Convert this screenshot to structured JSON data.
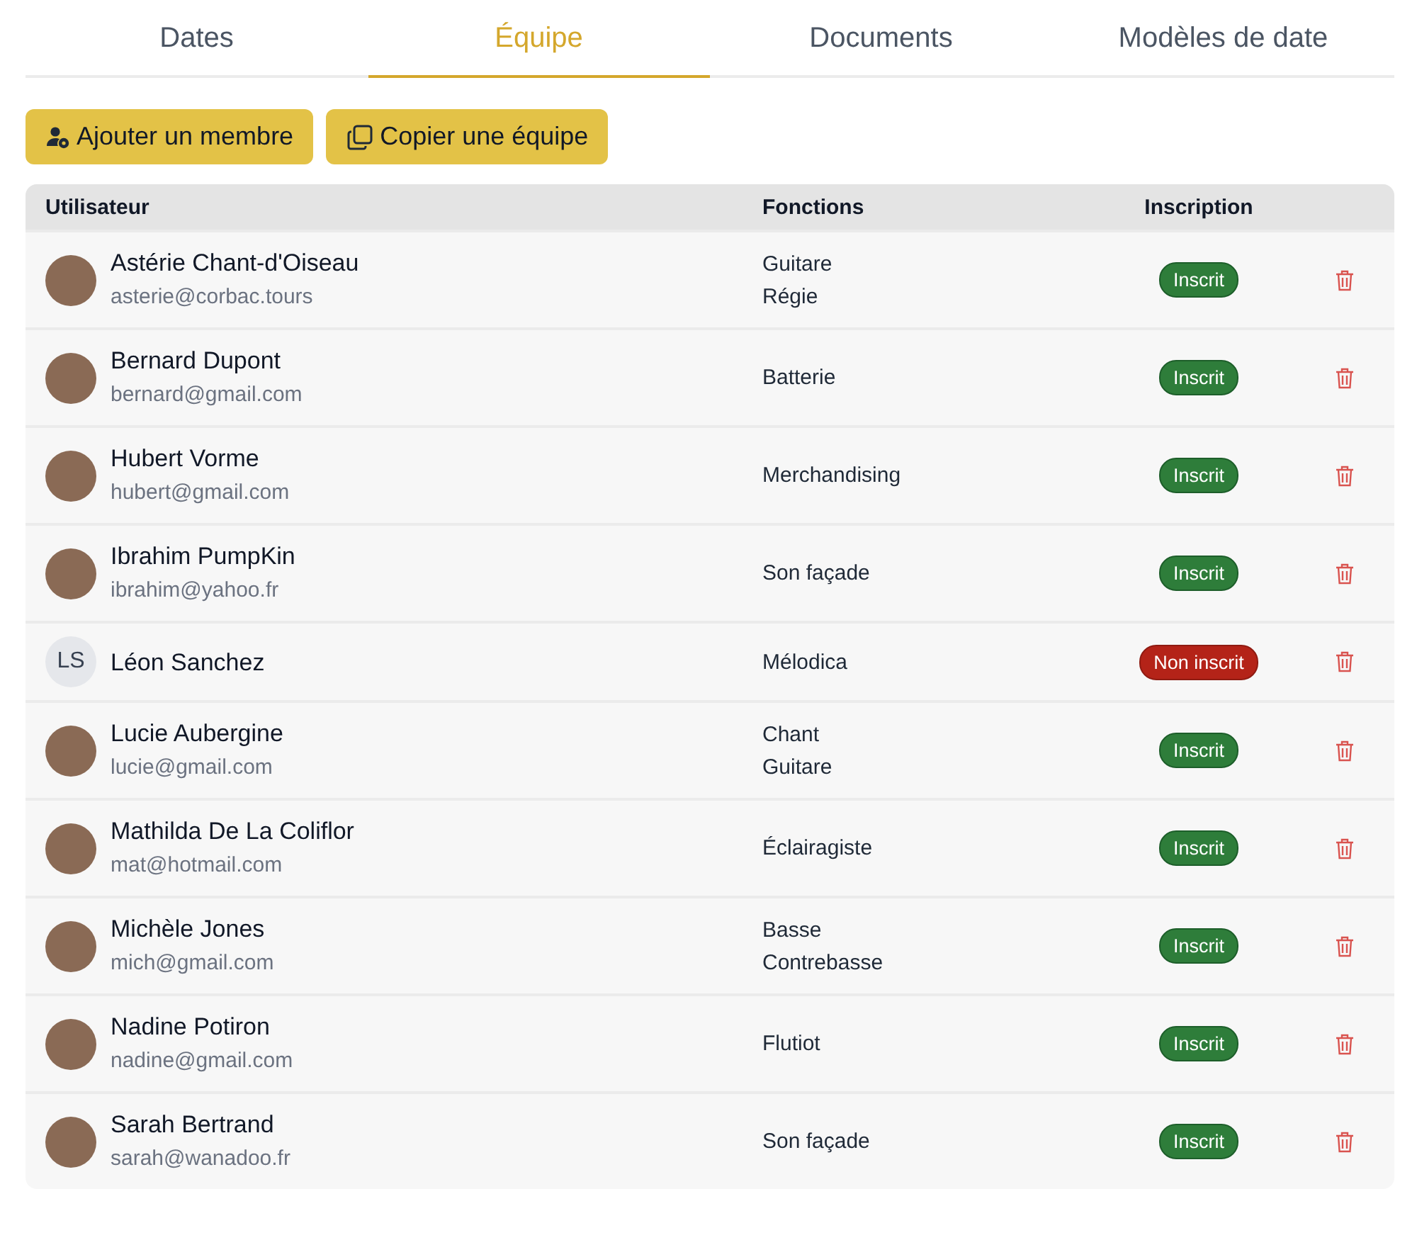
{
  "tabs": [
    {
      "label": "Dates",
      "selected": false
    },
    {
      "label": "Équipe",
      "selected": true
    },
    {
      "label": "Documents",
      "selected": false
    },
    {
      "label": "Modèles de date",
      "selected": false
    }
  ],
  "actions": [
    {
      "kind": "add-member",
      "label": "Ajouter un membre"
    },
    {
      "kind": "copy",
      "label": "Copier une équipe"
    }
  ],
  "table": {
    "columns": [
      "Utilisateur",
      "Fonctions",
      "Inscription"
    ],
    "rows": [
      {
        "name": "Astérie Chant-d'Oiseau",
        "email": "asterie@corbac.tours",
        "avatar": {
          "kind": "photo"
        },
        "functions": [
          "Guitare",
          "Régie"
        ],
        "status": "Inscrit",
        "registered": true
      },
      {
        "name": "Bernard Dupont",
        "email": "bernard@gmail.com",
        "avatar": {
          "kind": "photo"
        },
        "functions": [
          "Batterie"
        ],
        "status": "Inscrit",
        "registered": true
      },
      {
        "name": "Hubert Vorme",
        "email": "hubert@gmail.com",
        "avatar": {
          "kind": "photo"
        },
        "functions": [
          "Merchandising"
        ],
        "status": "Inscrit",
        "registered": true
      },
      {
        "name": "Ibrahim PumpKin",
        "email": "ibrahim@yahoo.fr",
        "avatar": {
          "kind": "photo"
        },
        "functions": [
          "Son façade"
        ],
        "status": "Inscrit",
        "registered": true
      },
      {
        "name": "Léon Sanchez",
        "avatar": {
          "kind": "initials",
          "text": "LS"
        },
        "functions": [
          "Mélodica"
        ],
        "status": "Non inscrit",
        "registered": false
      },
      {
        "name": "Lucie Aubergine",
        "email": "lucie@gmail.com",
        "avatar": {
          "kind": "photo"
        },
        "functions": [
          "Chant",
          "Guitare"
        ],
        "status": "Inscrit",
        "registered": true
      },
      {
        "name": "Mathilda De La Coliflor",
        "email": "mat@hotmail.com",
        "avatar": {
          "kind": "photo"
        },
        "functions": [
          "Éclairagiste"
        ],
        "status": "Inscrit",
        "registered": true
      },
      {
        "name": "Michèle Jones",
        "email": "mich@gmail.com",
        "avatar": {
          "kind": "photo"
        },
        "functions": [
          "Basse",
          "Contrebasse"
        ],
        "status": "Inscrit",
        "registered": true
      },
      {
        "name": "Nadine Potiron",
        "email": "nadine@gmail.com",
        "avatar": {
          "kind": "photo"
        },
        "functions": [
          "Flutiot"
        ],
        "status": "Inscrit",
        "registered": true
      },
      {
        "name": "Sarah Bertrand",
        "email": "sarah@wanadoo.fr",
        "avatar": {
          "kind": "photo"
        },
        "functions": [
          "Son façade"
        ],
        "status": "Inscrit",
        "registered": true
      }
    ]
  }
}
